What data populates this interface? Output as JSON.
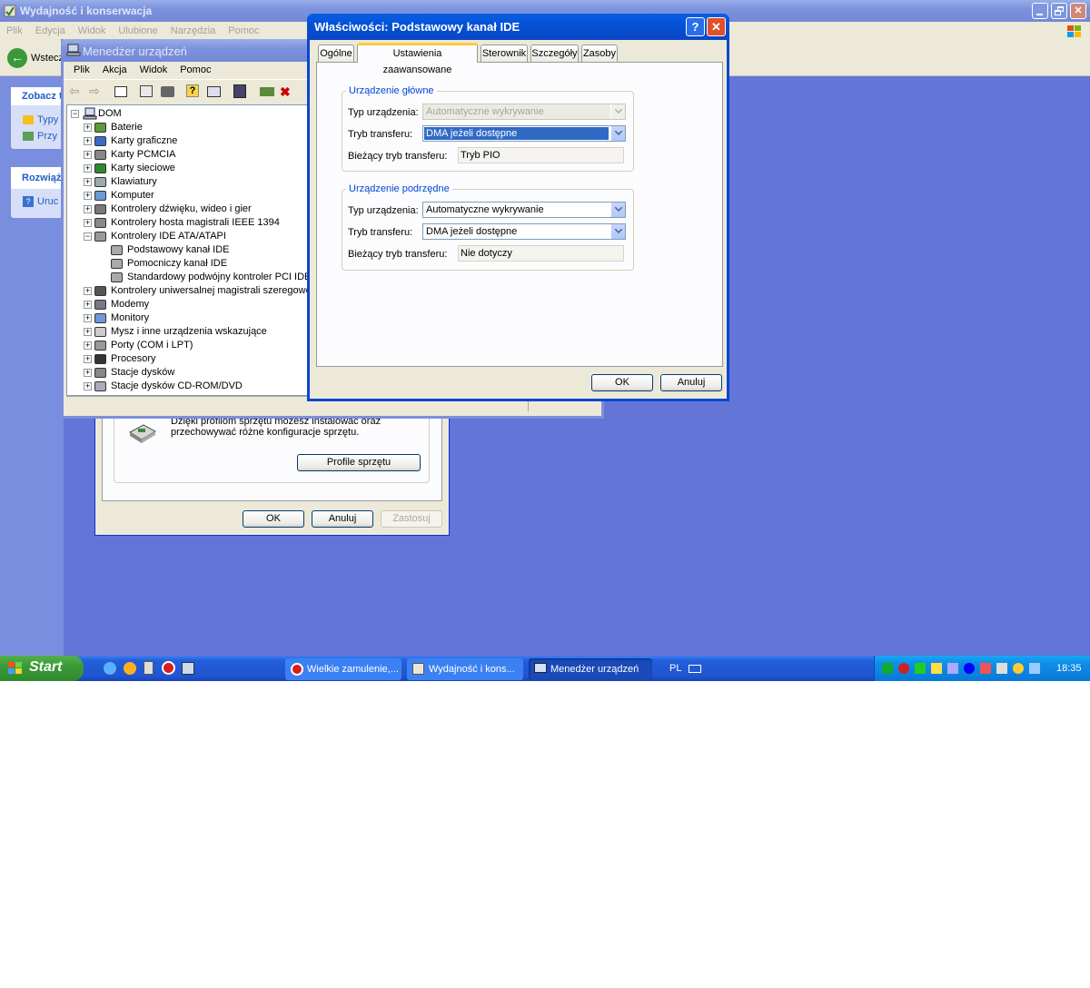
{
  "bg_window": {
    "title": "Wydajność i konserwacja",
    "menu": [
      "Plik",
      "Edycja",
      "Widok",
      "Ulubione",
      "Narzędzia",
      "Pomoc"
    ],
    "back_label": "Wstecz",
    "see_also_header": "Zobacz t",
    "see_also_items": [
      "Typy",
      "Przy"
    ],
    "troubleshoot_header": "Rozwiąż",
    "troubleshoot_item": "Uruc"
  },
  "sysprops": {
    "profile_text": "Dzięki profilom sprzętu możesz instalować oraz przechowywać różne konfiguracje sprzętu.",
    "profile_button": "Profile sprzętu",
    "ok": "OK",
    "cancel": "Anuluj",
    "apply": "Zastosuj"
  },
  "devmgr": {
    "title": "Menedżer urządzeń",
    "menu": [
      "Plik",
      "Akcja",
      "Widok",
      "Pomoc"
    ],
    "root": "DOM",
    "tree": [
      {
        "label": "Baterie",
        "icon": "battery-icon",
        "depth": 1,
        "pm": "+"
      },
      {
        "label": "Karty graficzne",
        "icon": "display-adapter-icon",
        "depth": 1,
        "pm": "+"
      },
      {
        "label": "Karty PCMCIA",
        "icon": "pcmcia-icon",
        "depth": 1,
        "pm": "+"
      },
      {
        "label": "Karty sieciowe",
        "icon": "network-card-icon",
        "depth": 1,
        "pm": "+"
      },
      {
        "label": "Klawiatury",
        "icon": "keyboard-icon",
        "depth": 1,
        "pm": "+"
      },
      {
        "label": "Komputer",
        "icon": "computer-icon",
        "depth": 1,
        "pm": "+"
      },
      {
        "label": "Kontrolery dźwięku, wideo i gier",
        "icon": "sound-icon",
        "depth": 1,
        "pm": "+"
      },
      {
        "label": "Kontrolery hosta magistrali IEEE 1394",
        "icon": "ieee1394-icon",
        "depth": 1,
        "pm": "+"
      },
      {
        "label": "Kontrolery IDE ATA/ATAPI",
        "icon": "ide-controller-icon",
        "depth": 1,
        "pm": "-"
      },
      {
        "label": "Podstawowy kanał IDE",
        "icon": "ide-channel-icon",
        "depth": 2,
        "pm": ""
      },
      {
        "label": "Pomocniczy kanał IDE",
        "icon": "ide-channel-icon",
        "depth": 2,
        "pm": ""
      },
      {
        "label": "Standardowy podwójny kontroler PCI IDE",
        "icon": "ide-channel-icon",
        "depth": 2,
        "pm": ""
      },
      {
        "label": "Kontrolery uniwersalnej magistrali szeregowej",
        "icon": "usb-icon",
        "depth": 1,
        "pm": "+"
      },
      {
        "label": "Modemy",
        "icon": "modem-icon",
        "depth": 1,
        "pm": "+"
      },
      {
        "label": "Monitory",
        "icon": "monitor-icon",
        "depth": 1,
        "pm": "+"
      },
      {
        "label": "Mysz i inne urządzenia wskazujące",
        "icon": "mouse-icon",
        "depth": 1,
        "pm": "+"
      },
      {
        "label": "Porty (COM i LPT)",
        "icon": "port-icon",
        "depth": 1,
        "pm": "+"
      },
      {
        "label": "Procesory",
        "icon": "processor-icon",
        "depth": 1,
        "pm": "+"
      },
      {
        "label": "Stacje dysków",
        "icon": "disk-drive-icon",
        "depth": 1,
        "pm": "+"
      },
      {
        "label": "Stacje dysków CD-ROM/DVD",
        "icon": "cdrom-icon",
        "depth": 1,
        "pm": "+"
      }
    ]
  },
  "dialog": {
    "title": "Właściwości: Podstawowy kanał IDE",
    "tabs": [
      "Ogólne",
      "Ustawienia zaawansowane",
      "Sterownik",
      "Szczegóły",
      "Zasoby"
    ],
    "selected_tab": 1,
    "primary": {
      "legend": "Urządzenie główne",
      "type_label": "Typ urządzenia:",
      "type_value": "Automatyczne wykrywanie",
      "transfer_label": "Tryb transferu:",
      "transfer_value": "DMA jeżeli dostępne",
      "current_label": "Bieżący tryb transferu:",
      "current_value": "Tryb PIO"
    },
    "secondary": {
      "legend": "Urządzenie podrzędne",
      "type_label": "Typ urządzenia:",
      "type_value": "Automatyczne wykrywanie",
      "transfer_label": "Tryb transferu:",
      "transfer_value": "DMA jeżeli dostępne",
      "current_label": "Bieżący tryb transferu:",
      "current_value": "Nie dotyczy"
    },
    "ok": "OK",
    "cancel": "Anuluj"
  },
  "taskbar": {
    "start": "Start",
    "tasks": [
      "Wielkie zamulenie,...",
      "Wydajność i kons...",
      "Menedżer urządzeń"
    ],
    "language": "PL",
    "clock": "18:35"
  },
  "colors": {
    "desktop": "#5a6fd2",
    "taskbar": "#245edb",
    "start": "#3c9a3a",
    "tray": "#0f8ee8",
    "accent_legend": "#0046d5",
    "selection": "#316ac5"
  }
}
